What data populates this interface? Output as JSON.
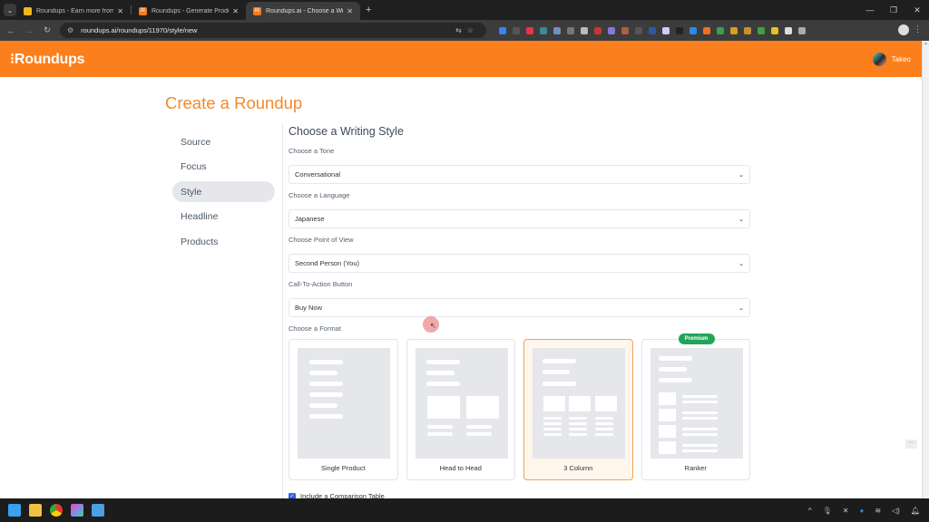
{
  "browser": {
    "tabs": [
      {
        "title": "Roundups - Earn more from yo",
        "favicon": "roundups-wing-icon",
        "favicon_color": "#f5b61b",
        "active": false
      },
      {
        "title": "Roundups - Generate Product I",
        "favicon": "roundups-r-icon",
        "favicon_color": "#f47c20",
        "active": false
      },
      {
        "title": "Roundups.ai - Choose a Writing",
        "favicon": "roundups-r-icon",
        "favicon_color": "#f47c20",
        "active": true
      }
    ],
    "url": "roundups.ai/roundups/11970/style/new",
    "extension_colors": [
      "#3b82f6",
      "#555",
      "#e34",
      "#3a8a9a",
      "#7090c0",
      "#777",
      "#bbb",
      "#c33",
      "#8878d8",
      "#b06040",
      "#555",
      "#2a5aa0",
      "#d8c8f8",
      "#222",
      "#2a8ae8",
      "#f07020",
      "#3aa050",
      "#d0a020",
      "#c89030",
      "#40a040",
      "#e8c020",
      "#ddd",
      "#aaa"
    ]
  },
  "header": {
    "logo": "⁝Roundups",
    "user_name": "Takeo",
    "brand_color": "#fb7f1c"
  },
  "page": {
    "title": "Create a Roundup"
  },
  "sidebar": {
    "items": [
      {
        "label": "Source",
        "active": false
      },
      {
        "label": "Focus",
        "active": false
      },
      {
        "label": "Style",
        "active": true
      },
      {
        "label": "Headline",
        "active": false
      },
      {
        "label": "Products",
        "active": false
      }
    ]
  },
  "form": {
    "section_title": "Choose a Writing Style",
    "tone": {
      "label": "Choose a Tone",
      "value": "Conversational"
    },
    "language": {
      "label": "Choose a Language",
      "value": "Japanese"
    },
    "point_of_view": {
      "label": "Choose Point of View",
      "value": "Second Person (You)"
    },
    "cta": {
      "label": "Call-To-Action Button",
      "value": "Buy Now"
    },
    "format": {
      "label": "Choose a Format",
      "options": [
        {
          "label": "Single Product",
          "selected": false,
          "badge": null
        },
        {
          "label": "Head to Head",
          "selected": false,
          "badge": null
        },
        {
          "label": "3 Column",
          "selected": true,
          "badge": null
        },
        {
          "label": "Ranker",
          "selected": false,
          "badge": "Premium"
        }
      ]
    },
    "comparison_table": {
      "label": "Include a Comparison Table",
      "checked": true
    }
  }
}
